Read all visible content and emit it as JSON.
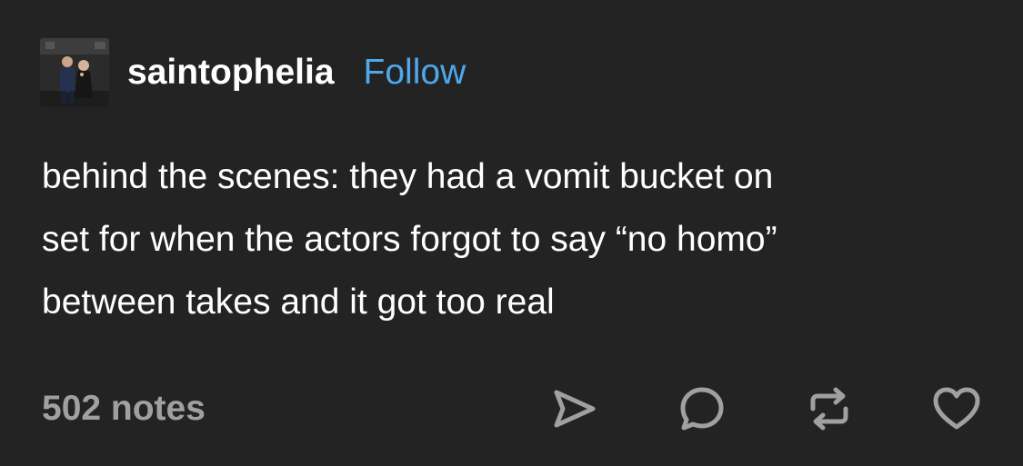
{
  "post": {
    "username": "saintophelia",
    "follow_label": "Follow",
    "body_lines": [
      "behind the scenes: they had a vomit bucket on",
      "set for when the actors forgot to say “no homo”",
      "between takes and it got too real"
    ],
    "notes_count": "502 notes"
  },
  "icons": {
    "share": "share-icon",
    "reply": "reply-icon",
    "reblog": "reblog-icon",
    "like": "heart-icon"
  },
  "colors": {
    "background": "#232323",
    "text": "#ffffff",
    "follow_link": "#4ea8ea",
    "muted": "#a0a0a0"
  }
}
